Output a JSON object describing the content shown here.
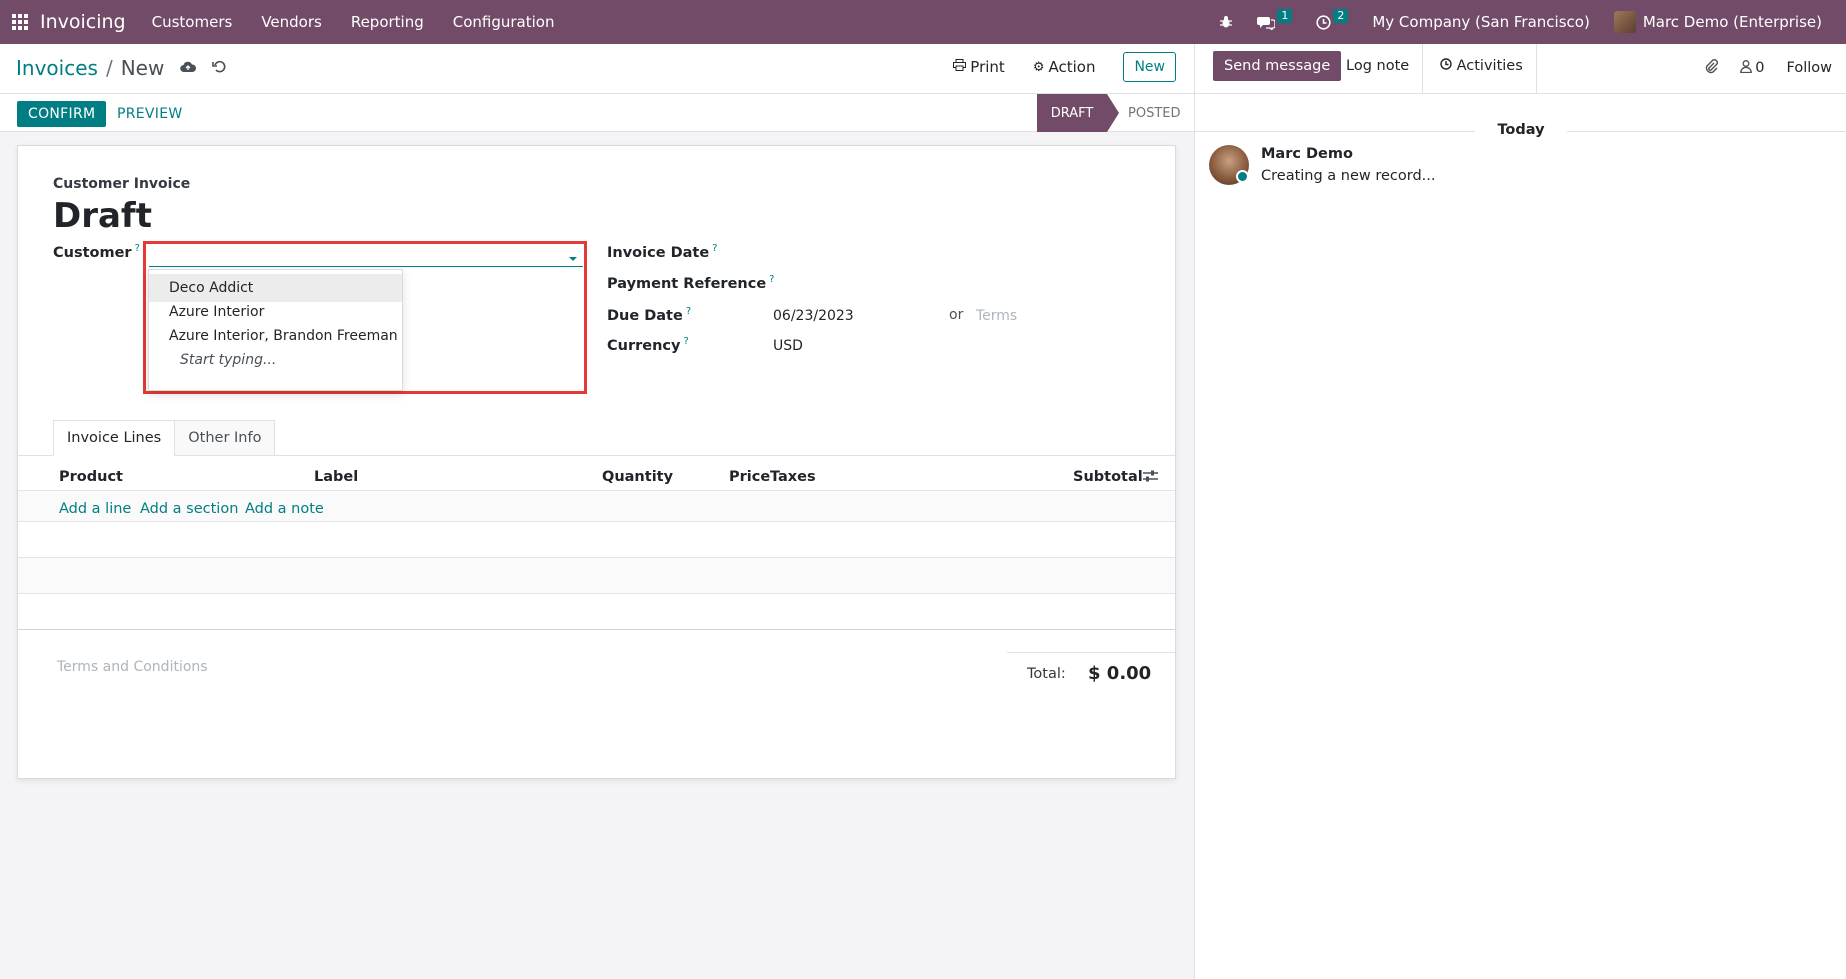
{
  "topbar": {
    "app_name": "Invoicing",
    "menu": [
      "Customers",
      "Vendors",
      "Reporting",
      "Configuration"
    ],
    "messages_count": "1",
    "activities_count": "2",
    "company": "My Company (San Francisco)",
    "user": "Marc Demo (Enterprise)"
  },
  "control_panel": {
    "breadcrumb_parent": "Invoices",
    "breadcrumb_current": "New",
    "print_label": "Print",
    "action_label": "Action",
    "new_label": "New"
  },
  "statusbar": {
    "confirm_label": "CONFIRM",
    "preview_label": "PREVIEW",
    "stages": [
      "DRAFT",
      "POSTED"
    ],
    "current_stage": "DRAFT"
  },
  "form": {
    "move_type": "Customer Invoice",
    "title": "Draft",
    "customer_label": "Customer",
    "customer_value": "",
    "customer_dropdown": [
      "Deco Addict",
      "Azure Interior",
      "Azure Interior, Brandon Freeman"
    ],
    "customer_dropdown_hint": "Start typing...",
    "invoice_date_label": "Invoice Date",
    "payment_reference_label": "Payment Reference",
    "due_date_label": "Due Date",
    "due_date_value": "06/23/2023",
    "or_label": "or",
    "terms_placeholder": "Terms",
    "currency_label": "Currency",
    "currency_value": "USD",
    "help_mark": "?"
  },
  "tabs": [
    "Invoice Lines",
    "Other Info"
  ],
  "lines_table": {
    "columns": [
      "Product",
      "Label",
      "Quantity",
      "Price",
      "Taxes",
      "Subtotal"
    ],
    "add_links": [
      "Add a line",
      "Add a section",
      "Add a note"
    ]
  },
  "footer": {
    "terms_placeholder": "Terms and Conditions",
    "total_label": "Total:",
    "total_value": "$ 0.00"
  },
  "chatter": {
    "send_message_label": "Send message",
    "log_note_label": "Log note",
    "activities_label": "Activities",
    "followers_count": "0",
    "follow_label": "Follow",
    "date_separator": "Today",
    "messages": [
      {
        "author": "Marc Demo",
        "body": "Creating a new record..."
      }
    ]
  },
  "colors": {
    "brand": "#714b67",
    "accent": "#017e84",
    "highlight_border": "#e53935"
  }
}
